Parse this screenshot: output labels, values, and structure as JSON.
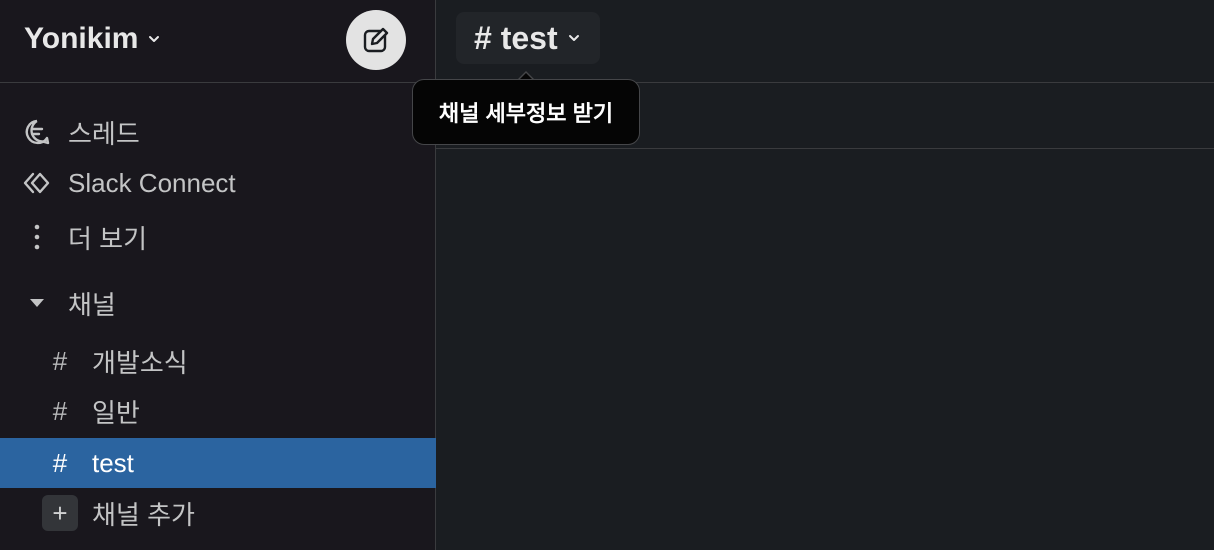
{
  "workspace": {
    "name": "Yonikim"
  },
  "compose": {
    "icon": "compose-icon"
  },
  "nav": [
    {
      "label": "스레드",
      "icon": "threads-icon"
    },
    {
      "label": "Slack Connect",
      "icon": "slack-connect-icon"
    },
    {
      "label": "더 보기",
      "icon": "more-vertical-icon"
    }
  ],
  "channels_section": {
    "label": "채널",
    "icon": "caret-down-icon"
  },
  "channels": [
    {
      "hash": "#",
      "label": "개발소식",
      "active": false
    },
    {
      "hash": "#",
      "label": "일반",
      "active": false
    },
    {
      "hash": "#",
      "label": "test",
      "active": true
    }
  ],
  "add_channel": {
    "plus": "+",
    "label": "채널 추가"
  },
  "header": {
    "channel_title": "# test"
  },
  "tooltip": {
    "text": "채널 세부정보 받기"
  },
  "colors": {
    "active_bg": "#2b64a0",
    "sidebar_bg": "#19171d",
    "main_bg": "#1a1d21"
  }
}
